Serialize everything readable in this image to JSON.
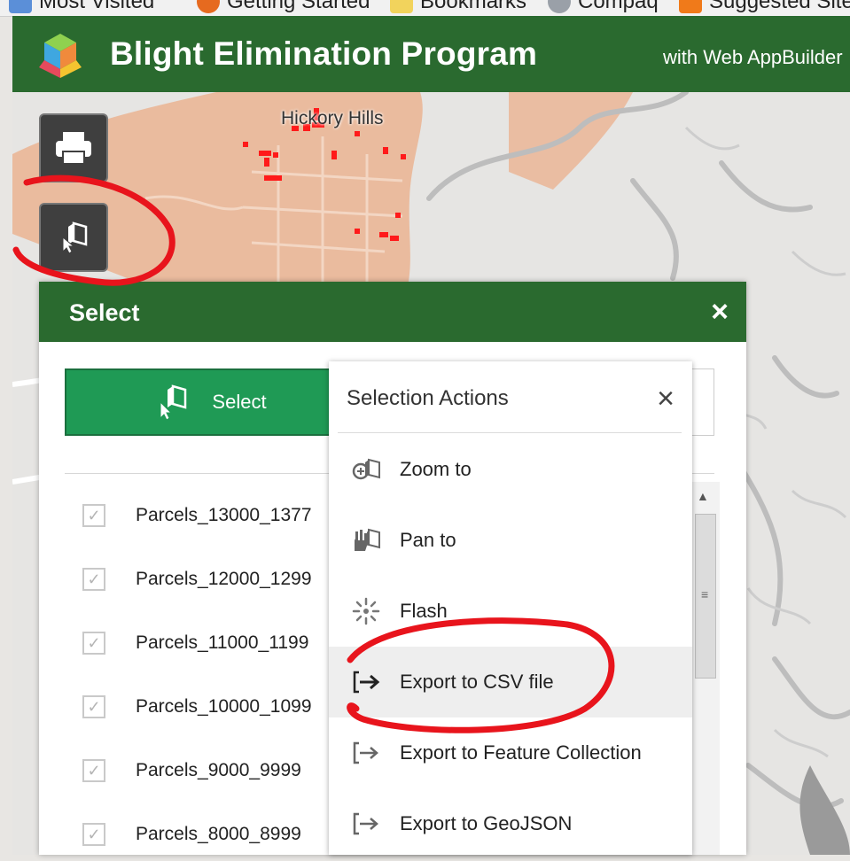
{
  "browser": {
    "bookmarks": [
      {
        "label": "Most Visited",
        "icon": "bookmark-star-icon"
      },
      {
        "label": "Getting Started",
        "icon": "firefox-icon"
      },
      {
        "label": "Bookmarks",
        "icon": "folder-icon"
      },
      {
        "label": "Compaq",
        "icon": "globe-icon"
      },
      {
        "label": "Suggested Sites",
        "icon": "suggested-sites-icon"
      }
    ]
  },
  "app": {
    "title": "Blight Elimination Program",
    "subtitle": "with Web AppBuilder",
    "colors": {
      "header": "#2a6a2f",
      "accent": "#1f9a55",
      "selection": "#ff0000",
      "parcel_area": "#eab89a"
    }
  },
  "map": {
    "place_label": "Hickory Hills"
  },
  "panel": {
    "title": "Select",
    "close": "×",
    "select_button": "Select",
    "layers": [
      {
        "label": "Parcels_13000_1377",
        "checked": true
      },
      {
        "label": "Parcels_12000_1299",
        "checked": true
      },
      {
        "label": "Parcels_11000_1199",
        "checked": true
      },
      {
        "label": "Parcels_10000_1099",
        "checked": true
      },
      {
        "label": "Parcels_9000_9999",
        "checked": true
      },
      {
        "label": "Parcels_8000_8999",
        "checked": true
      }
    ]
  },
  "actions": {
    "title": "Selection Actions",
    "close": "×",
    "items": [
      {
        "label": "Zoom to",
        "icon": "zoom-to-icon"
      },
      {
        "label": "Pan to",
        "icon": "pan-hand-icon"
      },
      {
        "label": "Flash",
        "icon": "flash-icon"
      },
      {
        "label": "Export to CSV file",
        "icon": "export-icon",
        "highlighted": true
      },
      {
        "label": "Export to Feature Collection",
        "icon": "export-icon"
      },
      {
        "label": "Export to GeoJSON",
        "icon": "export-icon"
      }
    ]
  }
}
